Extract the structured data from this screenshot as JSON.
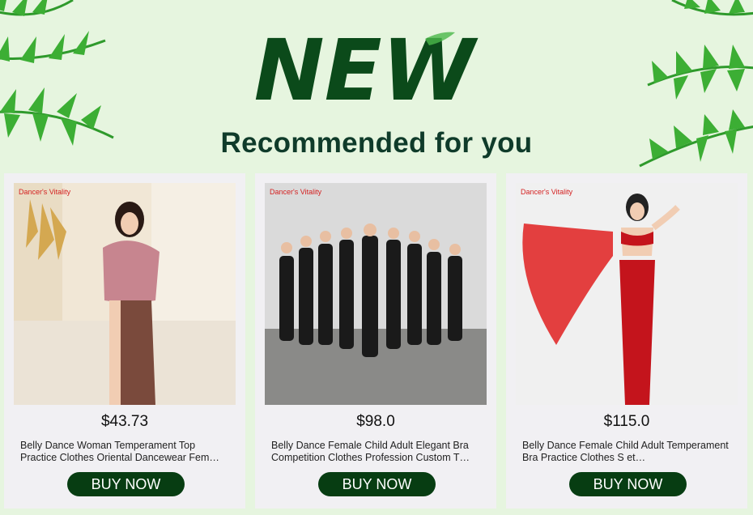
{
  "banner": {
    "logo_text": "NEW",
    "heading": "Recommended for you"
  },
  "colors": {
    "background": "#e6f5df",
    "heading": "#0f3b2a",
    "button": "#073d12",
    "brand": "#d42020",
    "card": "#f1f0f3"
  },
  "products": [
    {
      "brand": "Dancer's Vitality",
      "price": "$43.73",
      "title": "Belly Dance Woman Temperament Top Practice Clothes Oriental Dancewear Fem…",
      "button": "BUY NOW"
    },
    {
      "brand": "Dancer's Vitality",
      "price": "$98.0",
      "title": "Belly Dance Female Child Adult Elegant Bra Competition Clothes Profession Custom T…",
      "button": "BUY NOW"
    },
    {
      "brand": "Dancer's Vitality",
      "price": "$115.0",
      "title": "Belly Dance Female Child Adult Temperament Bra Practice Clothes S et…",
      "button": "BUY NOW"
    }
  ]
}
